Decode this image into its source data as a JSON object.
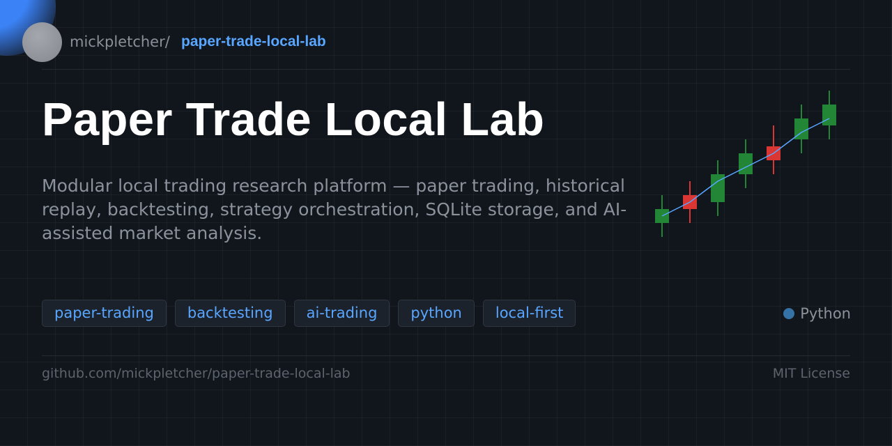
{
  "header": {
    "owner": "mickpletcher/",
    "repo": "paper-trade-local-lab"
  },
  "title": "Paper Trade Local Lab",
  "description": "Modular local trading research platform — paper trading, historical replay, backtesting, strategy orchestration, SQLite storage, and AI-assisted market analysis.",
  "topics": [
    "paper-trading",
    "backtesting",
    "ai-trading",
    "python",
    "local-first"
  ],
  "language": {
    "name": "Python",
    "color": "#3572a5"
  },
  "footer": {
    "url": "github.com/mickpletcher/paper-trade-local-lab",
    "license": "MIT License"
  },
  "colors": {
    "accent": "#58a6ff",
    "background": "#11151c",
    "candle_up": "#238636",
    "candle_down": "#da3633",
    "trend_line": "#58a6ff"
  },
  "chart_data": {
    "type": "candlestick",
    "candles": [
      {
        "open": 2,
        "close": 4,
        "high": 6,
        "low": 0,
        "direction": "up"
      },
      {
        "open": 6,
        "close": 4,
        "high": 8,
        "low": 2,
        "direction": "down"
      },
      {
        "open": 5,
        "close": 9,
        "high": 11,
        "low": 3,
        "direction": "up"
      },
      {
        "open": 9,
        "close": 12,
        "high": 14,
        "low": 7,
        "direction": "up"
      },
      {
        "open": 13,
        "close": 11,
        "high": 16,
        "low": 9,
        "direction": "down"
      },
      {
        "open": 14,
        "close": 17,
        "high": 19,
        "low": 12,
        "direction": "up"
      },
      {
        "open": 16,
        "close": 19,
        "high": 21,
        "low": 14,
        "direction": "up"
      }
    ],
    "trend": [
      3,
      5,
      8,
      10,
      12,
      15,
      17
    ],
    "ylim": [
      0,
      21
    ]
  }
}
